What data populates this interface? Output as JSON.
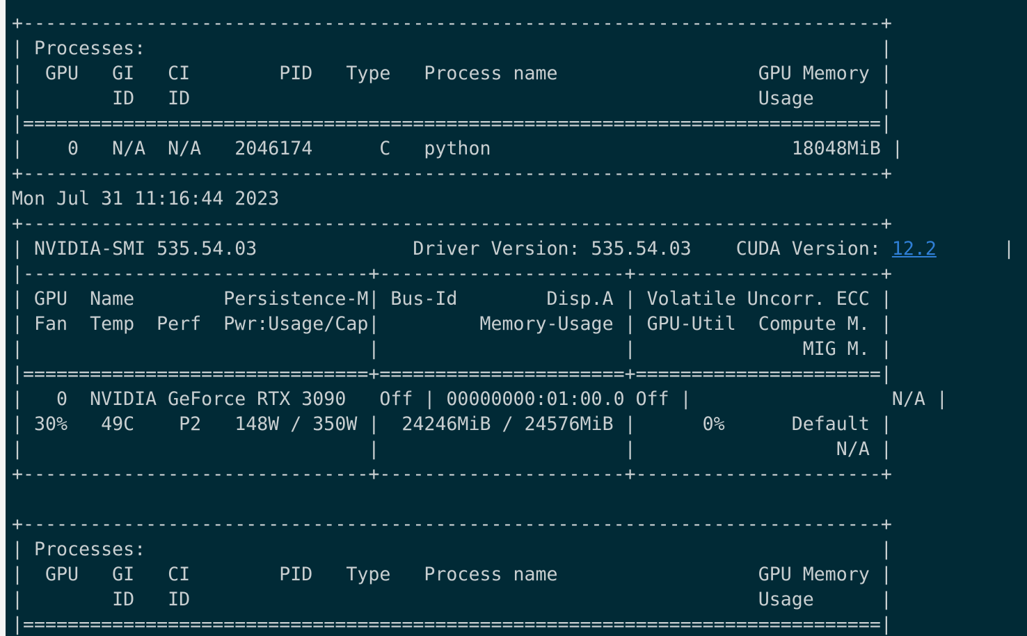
{
  "terminal": {
    "lines": [
      "+-----------------------------------------------------------------------------+",
      "| Processes:                                                                  |",
      "|  GPU   GI   CI        PID   Type   Process name                  GPU Memory |",
      "|        ID   ID                                                   Usage      |",
      "|=============================================================================|",
      "|    0   N/A  N/A   2046174      C   python                           18048MiB |",
      "+-----------------------------------------------------------------------------+",
      "Mon Jul 31 11:16:44 2023",
      "+-----------------------------------------------------------------------------+",
      "| NVIDIA-SMI 535.54.03              Driver Version: 535.54.03    CUDA Version: ",
      "|-------------------------------+----------------------+----------------------+",
      "| GPU  Name        Persistence-M| Bus-Id        Disp.A | Volatile Uncorr. ECC |",
      "| Fan  Temp  Perf  Pwr:Usage/Cap|         Memory-Usage | GPU-Util  Compute M. |",
      "|                               |                      |               MIG M. |",
      "|===============================+======================+======================|",
      "|   0  NVIDIA GeForce RTX 3090   Off | 00000000:01:00.0 Off |                  N/A |",
      "| 30%   49C    P2   148W / 350W |  24246MiB / 24576MiB |      0%      Default |",
      "|                               |                      |                  N/A |",
      "+-------------------------------+----------------------+----------------------+",
      "",
      "+-----------------------------------------------------------------------------+",
      "| Processes:                                                                  |",
      "|  GPU   GI   CI        PID   Type   Process name                  GPU Memory |",
      "|        ID   ID                                                   Usage      |",
      "|=============================================================================|"
    ],
    "cuda_version": "12.2",
    "cuda_line_tail": "      |"
  }
}
